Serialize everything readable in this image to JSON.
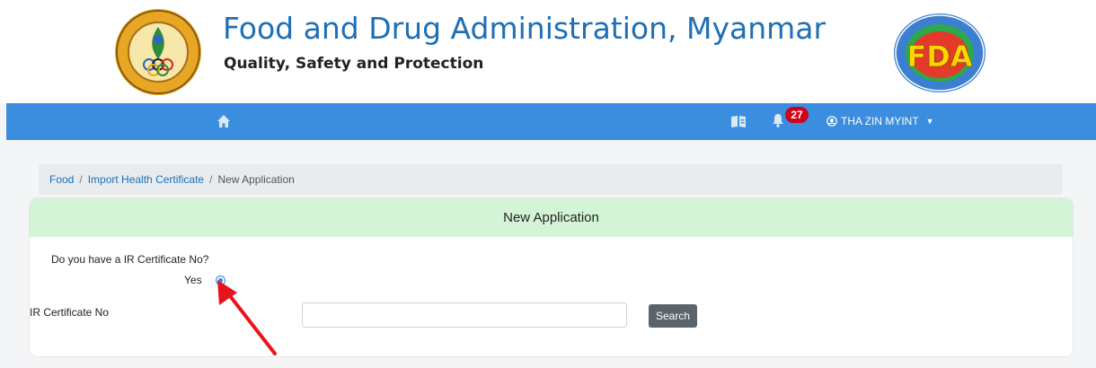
{
  "header": {
    "title": "Food and Drug Administration, Myanmar",
    "subtitle": "Quality, Safety and Protection",
    "left_logo_icon": "ministry-of-health-and-sports-seal",
    "right_logo_icon": "fda-department-seal"
  },
  "navbar": {
    "home_icon": "home-icon",
    "book_icon": "book-icon",
    "bell_icon": "bell-icon",
    "notification_count": "27",
    "user_name": "THA ZIN MYINT",
    "colors": {
      "bar": "#3b8ddd",
      "badge": "#d0021b"
    }
  },
  "breadcrumb": {
    "items": [
      "Food",
      "Import Health Certificate",
      "New Application"
    ],
    "separator": "/"
  },
  "card": {
    "title": "New Application",
    "header_color": "#d4f4d6",
    "question": "Do you have a IR Certificate No?",
    "yes_label": "Yes",
    "yes_selected": true,
    "ir_label": "IR Certificate No",
    "ir_value": "",
    "search_label": "Search"
  },
  "annotation": {
    "color": "#e8141b"
  }
}
